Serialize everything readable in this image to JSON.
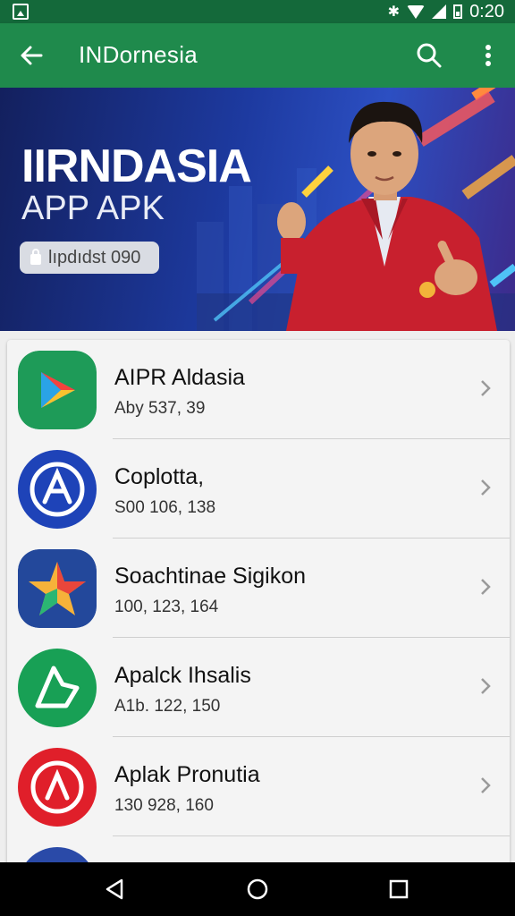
{
  "status_bar": {
    "time": "0:20",
    "icons": [
      "image-icon",
      "bluetooth-icon",
      "wifi-icon",
      "signal-icon",
      "battery-icon"
    ]
  },
  "app_bar": {
    "title": "INDornesia",
    "icons": [
      "back-arrow-icon",
      "search-icon",
      "more-vert-icon"
    ]
  },
  "banner": {
    "title": "IIRNDASIA",
    "subtitle": "APP APK",
    "pill": "lıpdıdst 090"
  },
  "apps": [
    {
      "name": "AIPR Aldasia",
      "meta": "Aby 537, 39",
      "icon": "google-play-icon",
      "color": "#1e9b58"
    },
    {
      "name": "Coplotta,",
      "meta": "S00 106, 138",
      "icon": "app-store-a-icon",
      "color": "#1e43b8"
    },
    {
      "name": "Soachtinae Sigikon",
      "meta": "100, 123, 164",
      "icon": "star-icon",
      "color": "#23489b"
    },
    {
      "name": "Apalck Ihsalis",
      "meta": "A1b. 122, 150",
      "icon": "leaf-shape-icon",
      "color": "#18a055"
    },
    {
      "name": "Aplak Pronutia",
      "meta": "130 928, 160",
      "icon": "a-circle-icon",
      "color": "#e01f2a"
    },
    {
      "name": "",
      "meta": "",
      "icon": "send-icon",
      "color": "#2a4aa8"
    }
  ],
  "colors": {
    "status_bar": "#14693a",
    "app_bar": "#1f8a4c",
    "background": "#eeeeee"
  },
  "nav_bar": {
    "icons": [
      "back-triangle-icon",
      "home-circle-icon",
      "recents-square-icon"
    ]
  }
}
